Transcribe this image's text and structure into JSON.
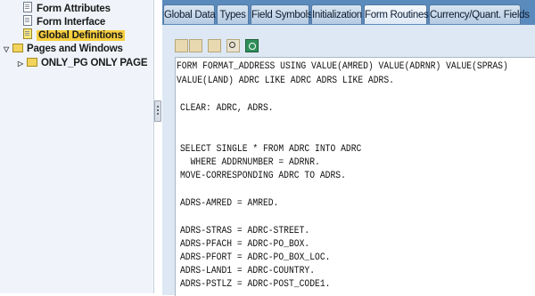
{
  "tree": {
    "items": [
      {
        "label": "Form Attributes"
      },
      {
        "label": "Form Interface"
      },
      {
        "label": "Global Definitions"
      },
      {
        "label": "Pages and Windows"
      },
      {
        "label": "ONLY_PG ONLY PAGE"
      }
    ]
  },
  "tabs": [
    {
      "label": "Global Data"
    },
    {
      "label": "Types"
    },
    {
      "label": "Field Symbols"
    },
    {
      "label": "Initialization"
    },
    {
      "label": "Form Routines"
    },
    {
      "label": "Currency/Quant. Fields"
    }
  ],
  "active_tab": "Form Routines",
  "toolbar": {
    "icons": [
      "cut-icon",
      "copy-icon",
      "paste-icon",
      "find-icon",
      "find-next-icon"
    ]
  },
  "code_lines": [
    "FORM FORMAT_ADDRESS USING VALUE(AMRED) VALUE(ADRNR) VALUE(SPRAS)",
    "VALUE(LAND) ADRC LIKE ADRC ADRS LIKE ADRS.",
    "CLEAR: ADRC, ADRS.",
    "SELECT SINGLE * FROM ADRC INTO ADRC",
    "  WHERE ADDRNUMBER = ADRNR.",
    "MOVE-CORRESPONDING ADRC TO ADRS.",
    "ADRS-AMRED = AMRED.",
    "ADRS-STRAS = ADRC-STREET.",
    "ADRS-PFACH = ADRC-PO_BOX.",
    "ADRS-PFORT = ADRC-PO_BOX_LOC.",
    "ADRS-LAND1 = ADRC-COUNTRY.",
    "ADRS-PSTLZ = ADRC-POST_CODE1."
  ],
  "colors": {
    "tabbar": "#5b8bbd",
    "selection": "#f7cf3e",
    "panel": "#dde8f4"
  }
}
